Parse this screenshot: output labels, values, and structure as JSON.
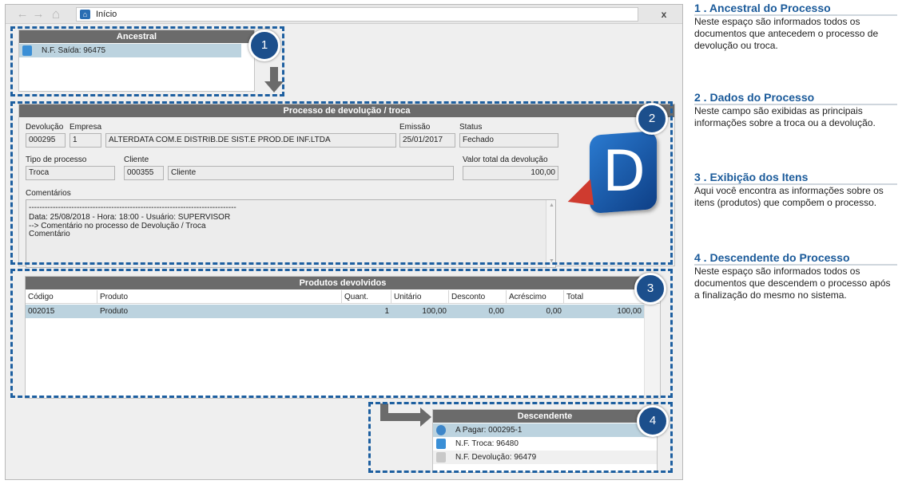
{
  "nav": {
    "back": "←",
    "forward": "→",
    "home": "⌂",
    "address_text": "Início",
    "close": "x"
  },
  "ancestral": {
    "title": "Ancestral",
    "items": [
      {
        "icon": "nf-document-icon",
        "label": "N.F. Saída: 96475"
      }
    ]
  },
  "process": {
    "title": "Processo de devolução / troca",
    "labels": {
      "devolucao": "Devolução",
      "empresa": "Empresa",
      "emissao": "Emissão",
      "status": "Status",
      "tipo": "Tipo de processo",
      "cliente": "Cliente",
      "valor": "Valor total da devolução",
      "comentarios": "Comentários"
    },
    "values": {
      "devolucao": "000295",
      "empresa_code": "1",
      "empresa_name": "ALTERDATA COM.E DISTRIB.DE SIST.E PROD.DE INF.LTDA",
      "emissao": "25/01/2017",
      "status": "Fechado",
      "tipo": "Troca",
      "cliente_code": "000355",
      "cliente_name": "Cliente",
      "valor": "100,00"
    },
    "comments": [
      "------------------------------------------------------------------------------",
      "Data: 25/08/2018 - Hora: 18:00 - Usuário: SUPERVISOR",
      "--> Comentário no processo de Devolução / Troca",
      "Comentário"
    ],
    "logo_letter": "D"
  },
  "products": {
    "title": "Produtos devolvidos",
    "columns": [
      "Código",
      "Produto",
      "Quant.",
      "Unitário",
      "Desconto",
      "Acréscimo",
      "Total"
    ],
    "rows": [
      [
        "002015",
        "Produto",
        "1",
        "100,00",
        "0,00",
        "0,00",
        "100,00"
      ]
    ]
  },
  "descendente": {
    "title": "Descendente",
    "items": [
      {
        "icon": "payment-icon",
        "label": "A Pagar: 000295-1"
      },
      {
        "icon": "nf-document-icon",
        "label": "N.F. Troca: 96480"
      },
      {
        "icon": "nf-grey-icon",
        "label": "N.F. Devolução: 96479"
      }
    ]
  },
  "badges": [
    "1",
    "2",
    "3",
    "4"
  ],
  "legend": [
    {
      "title": "1 . Ancestral do Processo",
      "text": "Neste espaço são informados todos os documentos que antecedem o processo de devolução ou troca."
    },
    {
      "title": "2 . Dados do Processo",
      "text": "Neste campo são exibidas as principais informações sobre a troca ou a devolução."
    },
    {
      "title": "3 . Exibição dos Itens",
      "text": "Aqui você encontra as informações sobre os itens (produtos) que compõem o processo."
    },
    {
      "title": "4 . Descendente do Processo",
      "text": "Neste espaço são informados todos os documentos que descendem o processo após a finalização do mesmo no sistema."
    }
  ],
  "colors": {
    "accent": "#1a5a9a",
    "badge": "#1c4f8c",
    "dash": "#1d5fa0",
    "header": "#6b6b6b",
    "selected": "#bcd3df"
  }
}
